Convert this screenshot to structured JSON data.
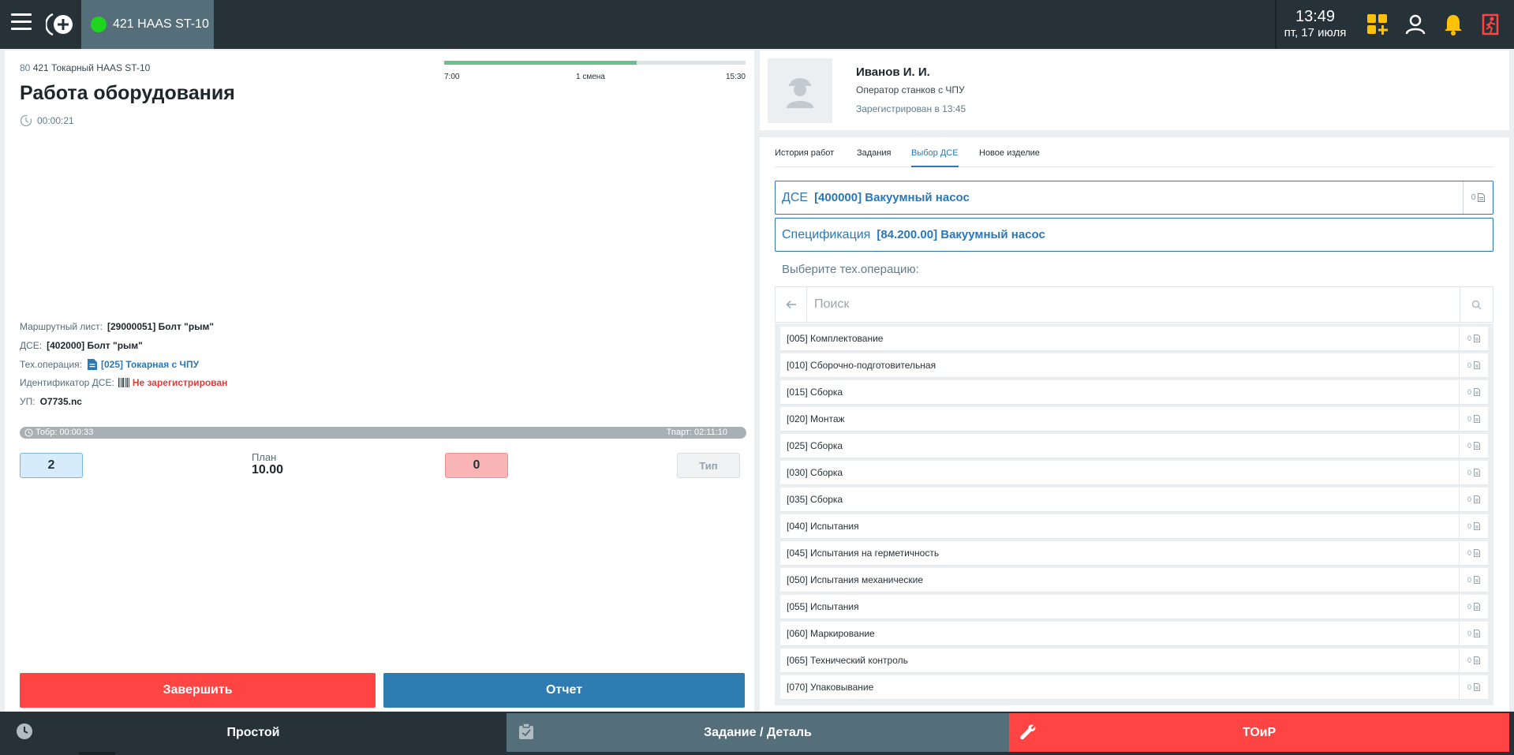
{
  "header": {
    "active_tab_label": "421 HAAS ST-10",
    "clock_time": "13:49",
    "clock_date": "пт, 17 июля",
    "status_color": "#1ed51e",
    "accent_color": "#ffc107",
    "logout_color": "#ff4444"
  },
  "machine": {
    "code": "80",
    "name": "421 Токарный HAAS ST-10",
    "title": "Работа оборудования",
    "timer": "00:00:21"
  },
  "shift": {
    "start": "7:00",
    "name": "1 смена",
    "end": "15:30",
    "progress_fraction": 0.64
  },
  "details": {
    "route_label": "Маршрутный лист:",
    "route_value": "[29000051] Болт \"рым\"",
    "dse_label": "ДСЕ:",
    "dse_value": "[402000] Болт \"рым\"",
    "techop_label": "Тех.операция:",
    "techop_value": "[025] Токарная с ЧПУ",
    "id_label": "Идентификатор ДСЕ:",
    "id_value": "Не зарегистрирован",
    "up_label": "УП:",
    "up_value": "O7735.nc"
  },
  "operation_bar": {
    "left": "Тобр: 00:00:33",
    "right": "Тпарт: 02:11:10"
  },
  "counts": {
    "good": "2",
    "plan_label": "План",
    "plan_value": "10.00",
    "bad": "0",
    "type_label": "Тип"
  },
  "actions": {
    "finish": "Завершить",
    "report": "Отчет"
  },
  "user": {
    "name": "Иванов И. И.",
    "role": "Оператор станков с ЧПУ",
    "registered": "Зарегистрирован в 13:45"
  },
  "tabs": [
    {
      "label": "История работ"
    },
    {
      "label": "Задания"
    },
    {
      "label": "Выбор ДСЕ"
    },
    {
      "label": "Новое изделие"
    }
  ],
  "selection": {
    "dse_label": "ДСЕ",
    "dse_value": "[400000] Вакуумный насос",
    "dse_count": "0",
    "spec_label": "Спецификация",
    "spec_value": "[84.200.00] Вакуумный насос",
    "choose_label": "Выберите тех.операцию:",
    "search_placeholder": "Поиск"
  },
  "operations": [
    {
      "name": "[005] Комплектование",
      "count": "0"
    },
    {
      "name": "[010] Сборочно-подготовительная",
      "count": "0"
    },
    {
      "name": "[015] Сборка",
      "count": "0"
    },
    {
      "name": "[020] Монтаж",
      "count": "0"
    },
    {
      "name": "[025] Сборка",
      "count": "0"
    },
    {
      "name": "[030] Сборка",
      "count": "0"
    },
    {
      "name": "[035] Сборка",
      "count": "0"
    },
    {
      "name": "[040] Испытания",
      "count": "0"
    },
    {
      "name": "[045] Испытания на герметичность",
      "count": "0"
    },
    {
      "name": "[050] Испытания механические",
      "count": "0"
    },
    {
      "name": "[055] Испытания",
      "count": "0"
    },
    {
      "name": "[060] Маркирование",
      "count": "0"
    },
    {
      "name": "[065] Технический контроль",
      "count": "0"
    },
    {
      "name": "[070] Упаковывание",
      "count": "0"
    }
  ],
  "bottom": {
    "idle": "Простой",
    "task": "Задание / Деталь",
    "maintenance": "ТОиР"
  }
}
